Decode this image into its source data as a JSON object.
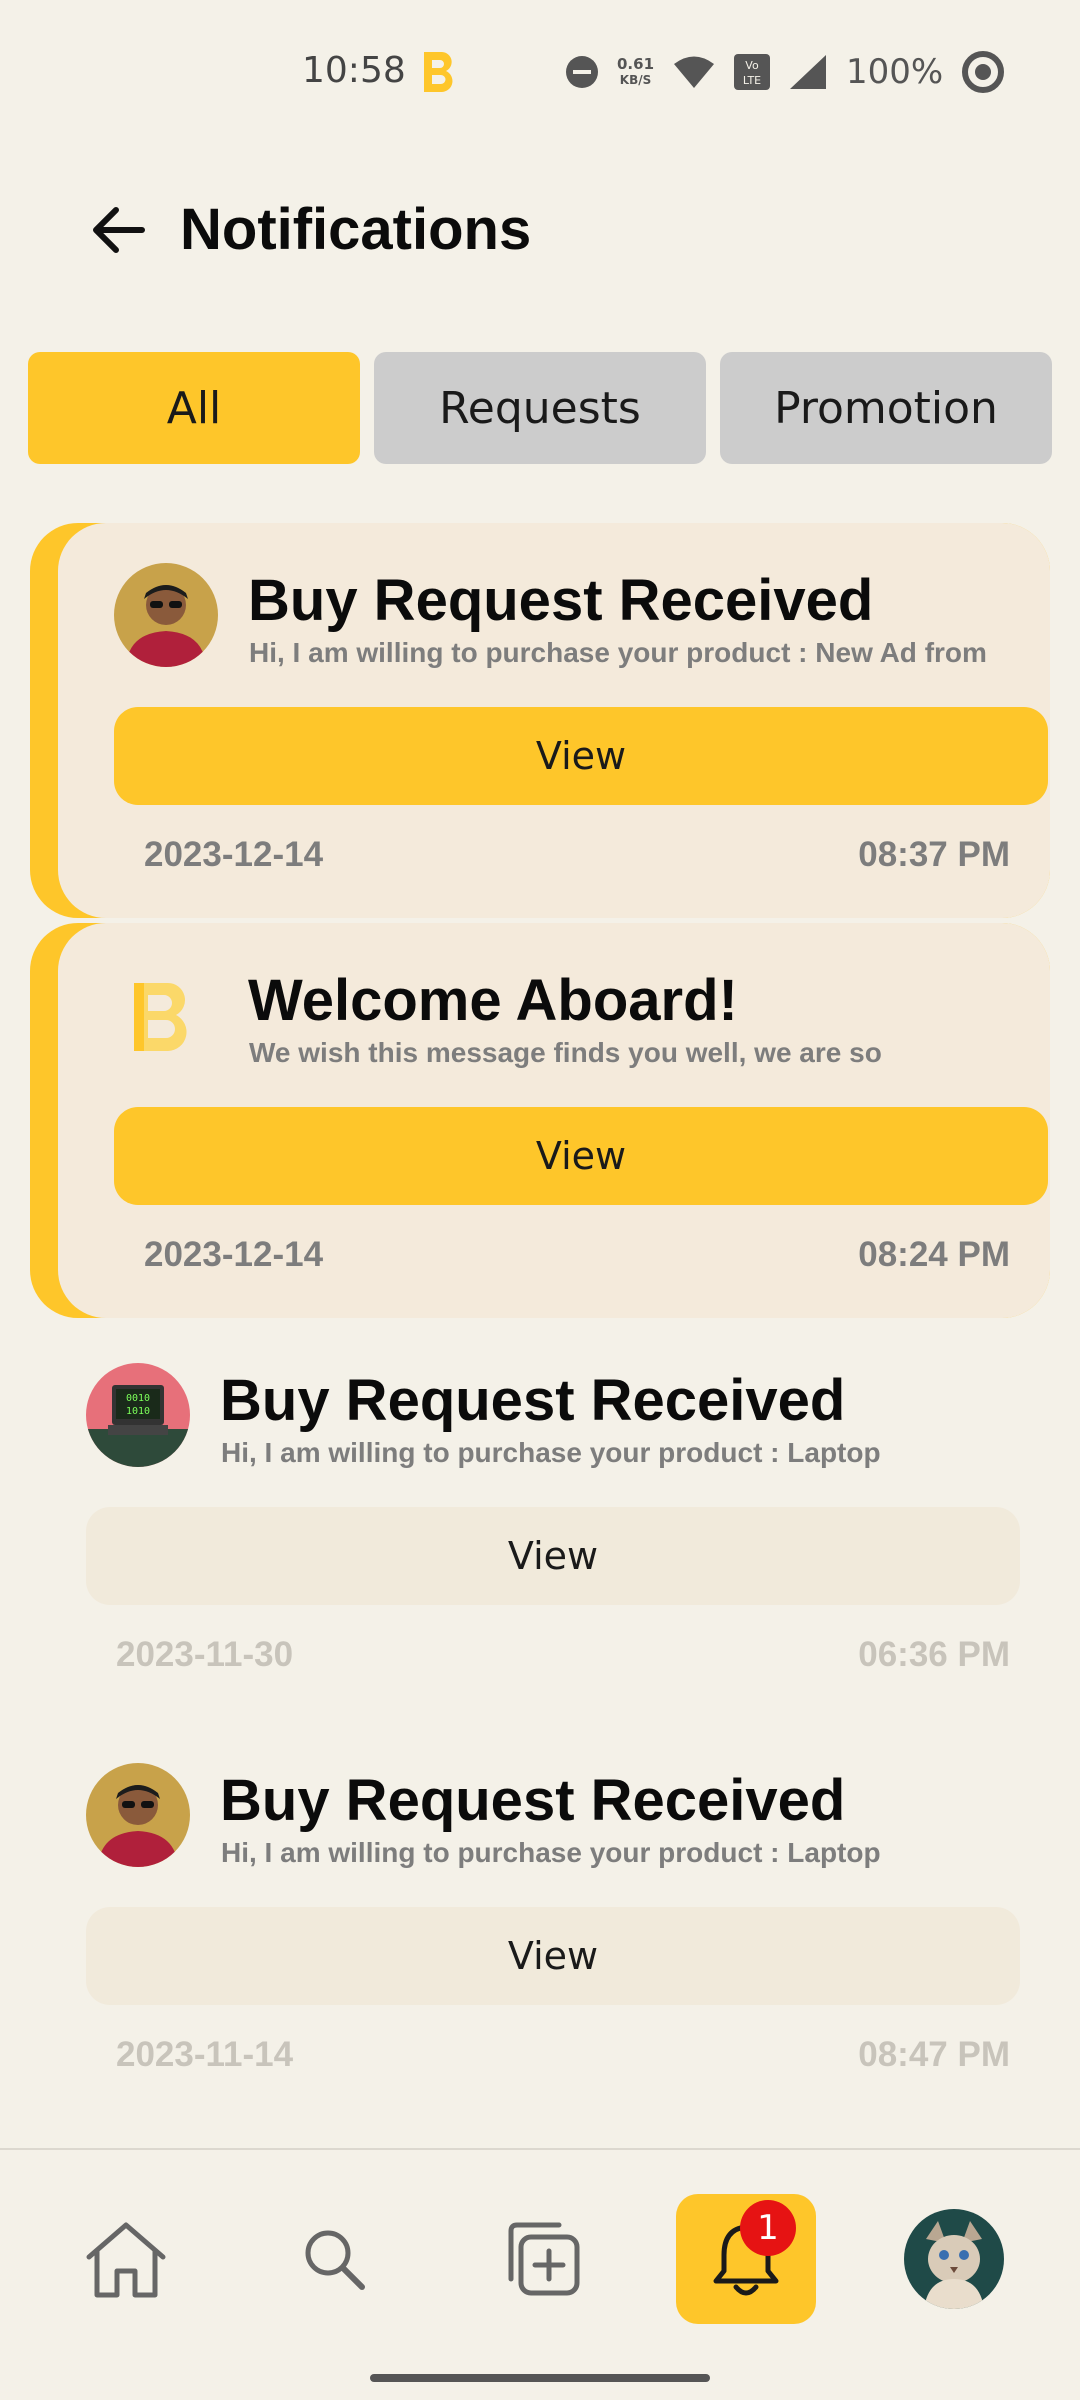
{
  "status_bar": {
    "time": "10:58",
    "net_speed_value": "0.61",
    "net_speed_unit": "KB/S",
    "battery": "100%"
  },
  "header": {
    "title": "Notifications",
    "back_icon": "arrow-left-icon"
  },
  "tabs": [
    {
      "label": "All",
      "active": true
    },
    {
      "label": "Requests",
      "active": false
    },
    {
      "label": "Promotion",
      "active": false
    }
  ],
  "notifications": [
    {
      "title": "Buy Request Received",
      "description": "Hi, I am willing to purchase your product : New Ad from",
      "button": "View",
      "date": "2023-12-14",
      "time": "08:37 PM",
      "unread": true,
      "avatar": "person-avatar"
    },
    {
      "title": "Welcome Aboard!",
      "description": "We wish this message finds you well, we are so",
      "button": "View",
      "date": "2023-12-14",
      "time": "08:24 PM",
      "unread": true,
      "avatar": "app-logo"
    },
    {
      "title": "Buy Request Received",
      "description": "Hi, I am willing to purchase your product : Laptop",
      "button": "View",
      "date": "2023-11-30",
      "time": "06:36 PM",
      "unread": false,
      "avatar": "computer-avatar"
    },
    {
      "title": "Buy Request Received",
      "description": "Hi, I am willing to purchase your product : Laptop",
      "button": "View",
      "date": "2023-11-14",
      "time": "08:47 PM",
      "unread": false,
      "avatar": "person-avatar"
    }
  ],
  "bottom_nav": {
    "items": [
      "home-icon",
      "search-icon",
      "add-post-icon",
      "bell-icon",
      "profile-avatar"
    ],
    "active": "bell-icon",
    "badge_count": "1"
  },
  "colors": {
    "accent": "#fec62a",
    "background": "#f4f1e8",
    "card": "#f4eadb",
    "badge": "#e61313"
  }
}
